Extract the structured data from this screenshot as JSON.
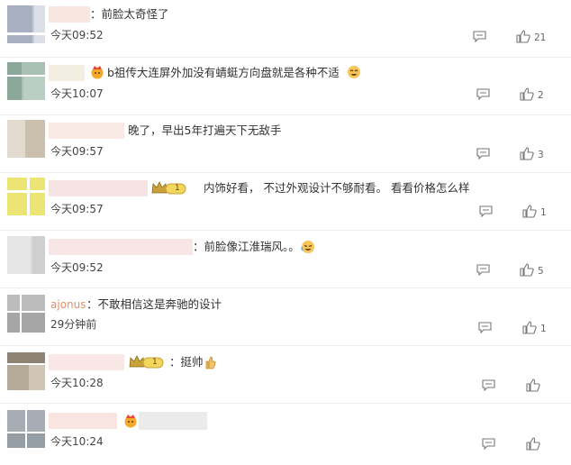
{
  "comments": [
    {
      "text": "：前脸太奇怪了",
      "time": "今天09:52",
      "likes": "21"
    },
    {
      "text": "b祖传大连屏外加没有蜻蜓方向盘就是各种不适",
      "time": "今天10:07",
      "likes": "2"
    },
    {
      "text": "晚了，早出5年打遍天下无敌手",
      "time": "今天09:57",
      "likes": "3"
    },
    {
      "text": "内饰好看，  不过外观设计不够耐看。 看看价格怎么样",
      "time": "今天09:57",
      "likes": "1",
      "badge": "1"
    },
    {
      "text": "：前脸像江淮瑞风。。",
      "time": "今天09:52",
      "likes": "5"
    },
    {
      "user": "ajonus",
      "text": "：不敢相信这是奔驰的设计",
      "time": "29分钟前",
      "likes": "1"
    },
    {
      "text": "：挺帅",
      "time": "今天10:28",
      "likes": "",
      "badge": "1"
    },
    {
      "text": "",
      "time": "今天10:24",
      "likes": ""
    }
  ],
  "colors": {
    "user_name": "#e0916a",
    "badge_gold": "#c9a23a",
    "text": "#333333",
    "meta": "#666666"
  },
  "icons": [
    "reply-icon",
    "thumbs-up-icon",
    "crown-badge-icon",
    "emoji-icon"
  ]
}
